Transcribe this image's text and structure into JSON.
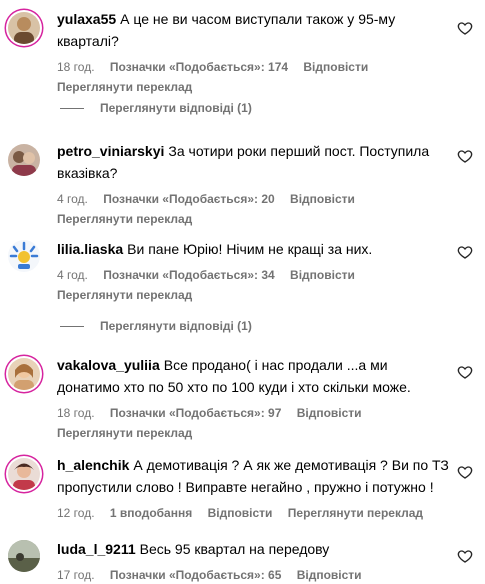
{
  "comments": [
    {
      "username": "yulaxa55",
      "text": "А це не ви часом виступали також у 95-му кварталі?",
      "time": "18 год.",
      "likes": "Позначки «Подобається»: 174",
      "reply": "Відповісти",
      "translate": "Переглянути переклад",
      "replies_label": "Переглянути відповіді (1)"
    },
    {
      "username": "petro_viniarskyi",
      "text": "За чотири роки перший пост. Поступила вказівка?",
      "time": "4 год.",
      "likes": "Позначки «Подобається»: 20",
      "reply": "Відповісти",
      "translate": "Переглянути переклад"
    },
    {
      "username": "lilia.liaska",
      "text": "Ви пане Юрію! Нічим не кращі за них.",
      "time": "4 год.",
      "likes": "Позначки «Подобається»: 34",
      "reply": "Відповісти",
      "translate": "Переглянути переклад",
      "replies_label": "Переглянути відповіді (1)"
    },
    {
      "username": "vakalova_yuliia",
      "text": "Все продано( і нас продали ...а ми донатимо хто по 50 хто по 100 куди і хто скільки може.",
      "time": "18 год.",
      "likes": "Позначки «Подобається»: 97",
      "reply": "Відповісти",
      "translate": "Переглянути переклад"
    },
    {
      "username": "h_alenchik",
      "text": "А демотивація ? А як же демотивація ? Ви по ТЗ пропустили слово ! Виправте негайно , пружно і потужно !",
      "time": "12 год.",
      "likes": "1 вподобання",
      "reply": "Відповісти",
      "translate": "Переглянути переклад"
    },
    {
      "username": "luda_l_9211",
      "text": "Весь 95 квартал на передову",
      "time": "17 год.",
      "likes": "Позначки «Подобається»: 65",
      "reply": "Відповісти"
    }
  ],
  "icons": {
    "heart": "heart-outline-icon"
  },
  "colors": {
    "secondary_text": "#737373",
    "story_ring": "#d6249f"
  }
}
